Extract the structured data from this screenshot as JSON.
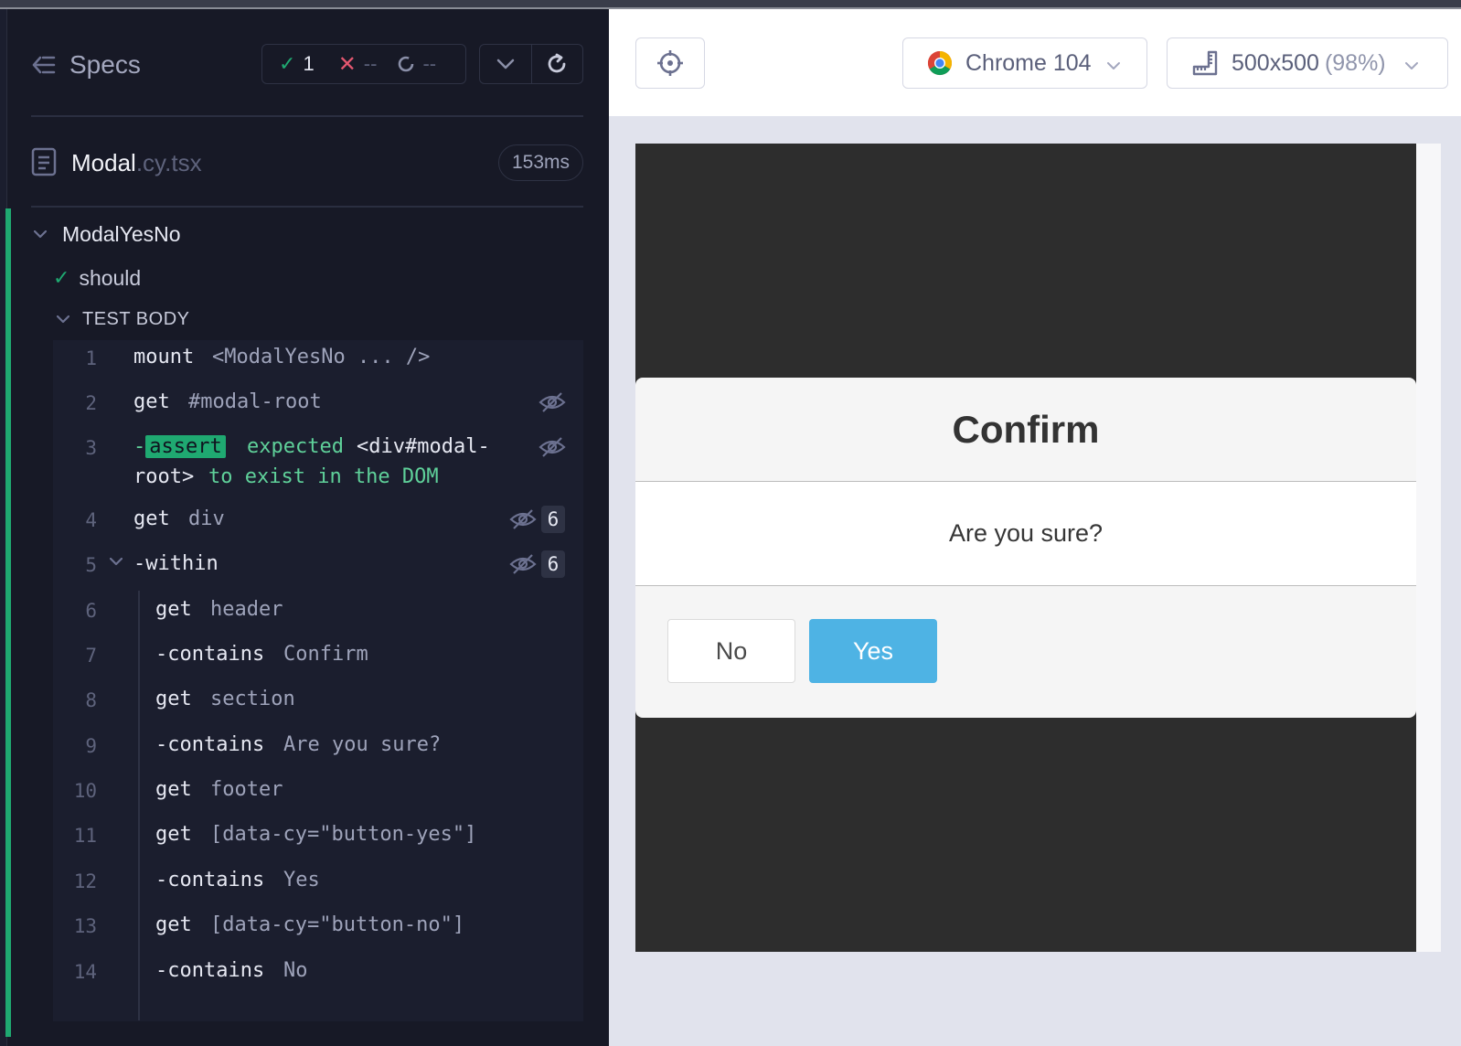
{
  "colors": {
    "pass": "#1fa971",
    "fail": "#e45770",
    "sidebar_bg": "#171926",
    "yes_button": "#4eb3e4"
  },
  "sidebar": {
    "title": "Specs",
    "stats": {
      "passed": "1",
      "failed": "--",
      "pending": "--"
    },
    "file": {
      "name": "Modal",
      "ext": ".cy.tsx",
      "duration": "153ms"
    },
    "suite": "ModalYesNo",
    "test": "should",
    "body_label": "TEST BODY",
    "commands": [
      {
        "num": "1",
        "name": "mount",
        "arg": "<ModalYesNo ... />"
      },
      {
        "num": "2",
        "name": "get",
        "arg": "#modal-root"
      },
      {
        "num": "3",
        "prefix": "-",
        "tag": "assert",
        "msg_a": "expected",
        "msg_b": "<div#modal-",
        "msg_c": "root>",
        "msg_d": "to exist in the DOM"
      },
      {
        "num": "4",
        "name": "get",
        "arg": "div",
        "count": "6"
      },
      {
        "num": "5",
        "name": "-within",
        "count": "6"
      },
      {
        "num": "6",
        "name": "get",
        "arg": "header"
      },
      {
        "num": "7",
        "name": "-contains",
        "arg": "Confirm"
      },
      {
        "num": "8",
        "name": "get",
        "arg": "section"
      },
      {
        "num": "9",
        "name": "-contains",
        "arg": "Are you sure?"
      },
      {
        "num": "10",
        "name": "get",
        "arg": "footer"
      },
      {
        "num": "11",
        "name": "get",
        "arg": "[data-cy=\"button-yes\"]"
      },
      {
        "num": "12",
        "name": "-contains",
        "arg": "Yes"
      },
      {
        "num": "13",
        "name": "get",
        "arg": "[data-cy=\"button-no\"]"
      },
      {
        "num": "14",
        "name": "-contains",
        "arg": "No"
      }
    ]
  },
  "toolbar": {
    "browser": "Chrome 104",
    "viewport": "500x500",
    "zoom": "(98%)"
  },
  "modal": {
    "title": "Confirm",
    "body": "Are you sure?",
    "no_label": "No",
    "yes_label": "Yes"
  }
}
